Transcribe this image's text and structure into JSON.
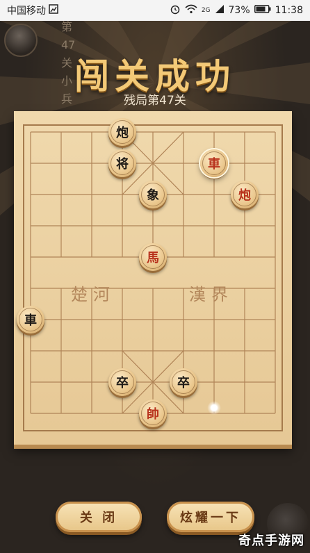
{
  "status_bar": {
    "carrier": "中国移动",
    "network": "2G",
    "battery": "73%",
    "time": "11:38"
  },
  "player": {
    "level_label": "第47关",
    "name": "小兵"
  },
  "header": {
    "title": "闯关成功",
    "subtitle": "残局第47关"
  },
  "board": {
    "river_left": "楚河",
    "river_right": "漢界",
    "pieces": [
      {
        "char": "炮",
        "side": "black",
        "col": 3,
        "row": 0
      },
      {
        "char": "将",
        "side": "black",
        "col": 3,
        "row": 1
      },
      {
        "char": "車",
        "side": "red",
        "col": 6,
        "row": 1,
        "selected": true
      },
      {
        "char": "象",
        "side": "black",
        "col": 4,
        "row": 2
      },
      {
        "char": "炮",
        "side": "red",
        "col": 7,
        "row": 2
      },
      {
        "char": "馬",
        "side": "red",
        "col": 4,
        "row": 4
      },
      {
        "char": "車",
        "side": "black",
        "col": 0,
        "row": 6
      },
      {
        "char": "卒",
        "side": "black",
        "col": 3,
        "row": 8
      },
      {
        "char": "卒",
        "side": "black",
        "col": 5,
        "row": 8
      },
      {
        "char": "帥",
        "side": "red",
        "col": 4,
        "row": 9
      }
    ]
  },
  "buttons": {
    "close": "关 闭",
    "share": "炫耀一下"
  },
  "watermark": "奇点手游网",
  "colors": {
    "background": "#2b2520",
    "title_gold": "#f3c977",
    "board": "#f0d9ad",
    "red_piece_text": "#b8321c",
    "black_piece_text": "#1e1a16"
  }
}
